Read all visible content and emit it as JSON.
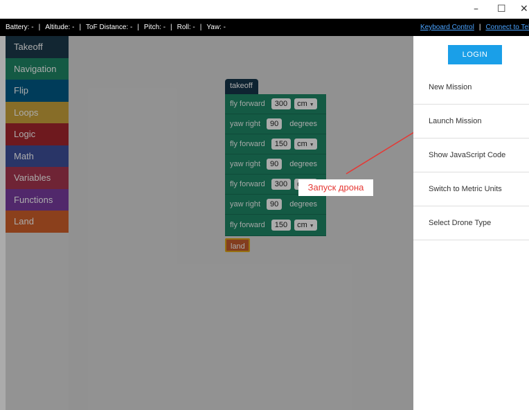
{
  "window": {
    "minimize": "–",
    "maximize": "☐",
    "close": "✕"
  },
  "status": {
    "battery": "Battery: -",
    "altitude": "Altitude: -",
    "tof": "ToF Distance: -",
    "pitch": "Pitch: -",
    "roll": "Roll: -",
    "yaw": "Yaw: -",
    "separator": "|",
    "keyboard_link": "Keyboard Control",
    "connect_link": "Connect to Tello"
  },
  "toolbox": [
    {
      "label": "Takeoff",
      "color": "#1b3a4b"
    },
    {
      "label": "Navigation",
      "color": "#1e8766"
    },
    {
      "label": "Flip",
      "color": "#005a87"
    },
    {
      "label": "Loops",
      "color": "#c9a33c"
    },
    {
      "label": "Logic",
      "color": "#a4262e"
    },
    {
      "label": "Math",
      "color": "#3e4f9a"
    },
    {
      "label": "Variables",
      "color": "#a6364f"
    },
    {
      "label": "Functions",
      "color": "#7a3ca0"
    },
    {
      "label": "Land",
      "color": "#d0602b"
    }
  ],
  "blocks": {
    "takeoff": "takeoff",
    "land": "land",
    "steps": [
      {
        "action": "fly forward",
        "value": "300",
        "unit": "cm"
      },
      {
        "action": "yaw right",
        "value": "90",
        "unit": "degrees"
      },
      {
        "action": "fly forward",
        "value": "150",
        "unit": "cm"
      },
      {
        "action": "yaw right",
        "value": "90",
        "unit": "degrees"
      },
      {
        "action": "fly forward",
        "value": "300",
        "unit": "cm"
      },
      {
        "action": "yaw right",
        "value": "90",
        "unit": "degrees"
      },
      {
        "action": "fly forward",
        "value": "150",
        "unit": "cm"
      }
    ],
    "caret": "▼"
  },
  "callout": "Запуск дрона",
  "panel": {
    "login": "LOGIN",
    "menu": [
      "New Mission",
      "Launch Mission",
      "Show JavaScript Code",
      "Switch to Metric Units",
      "Select Drone Type"
    ]
  },
  "colors": {
    "accent": "#1a9fe8",
    "annotation": "#e53935",
    "link": "#4aa3ff"
  }
}
